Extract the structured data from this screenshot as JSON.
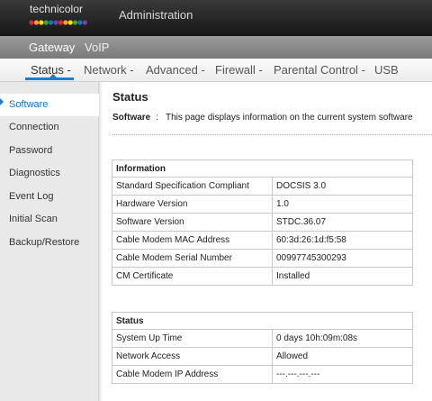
{
  "header": {
    "logo_text": "technicolor",
    "logo_dot_colors": [
      "#e3262b",
      "#f7a11a",
      "#f6e500",
      "#2fa84f",
      "#1b75bb",
      "#7a3f98",
      "#e3262b",
      "#f7a11a",
      "#f6e500",
      "#2fa84f",
      "#1b75bb",
      "#7a3f98"
    ],
    "title": "Administration"
  },
  "subnav": {
    "items": [
      "Gateway",
      "VoIP"
    ],
    "active": "Gateway"
  },
  "mainnav": {
    "items": [
      "Status -",
      "Network -",
      "Advanced -",
      "Firewall -",
      "Parental Control -",
      "USB"
    ],
    "active": "Status -",
    "accent_color": "#1a7fd1"
  },
  "sidebar": {
    "items": [
      "Software",
      "Connection",
      "Password",
      "Diagnostics",
      "Event Log",
      "Initial Scan",
      "Backup/Restore"
    ],
    "active": "Software"
  },
  "content": {
    "title": "Status",
    "desc_label": "Software",
    "desc_sep": ":",
    "desc_text": "This page displays information on the current system software",
    "info_table": {
      "header": "Information",
      "rows": [
        [
          "Standard Specification Compliant",
          "DOCSIS 3.0"
        ],
        [
          "Hardware Version",
          "1.0"
        ],
        [
          "Software Version",
          "STDC.36.07"
        ],
        [
          "Cable Modem MAC Address",
          "60:3d:26:1d:f5:58"
        ],
        [
          "Cable Modem Serial Number",
          "00997745300293"
        ],
        [
          "CM Certificate",
          "Installed"
        ]
      ]
    },
    "status_table": {
      "header": "Status",
      "rows": [
        [
          "System Up Time",
          "0 days 10h:09m:08s"
        ],
        [
          "Network Access",
          "Allowed"
        ],
        [
          "Cable Modem IP Address",
          "---.---.---.---"
        ]
      ]
    }
  }
}
